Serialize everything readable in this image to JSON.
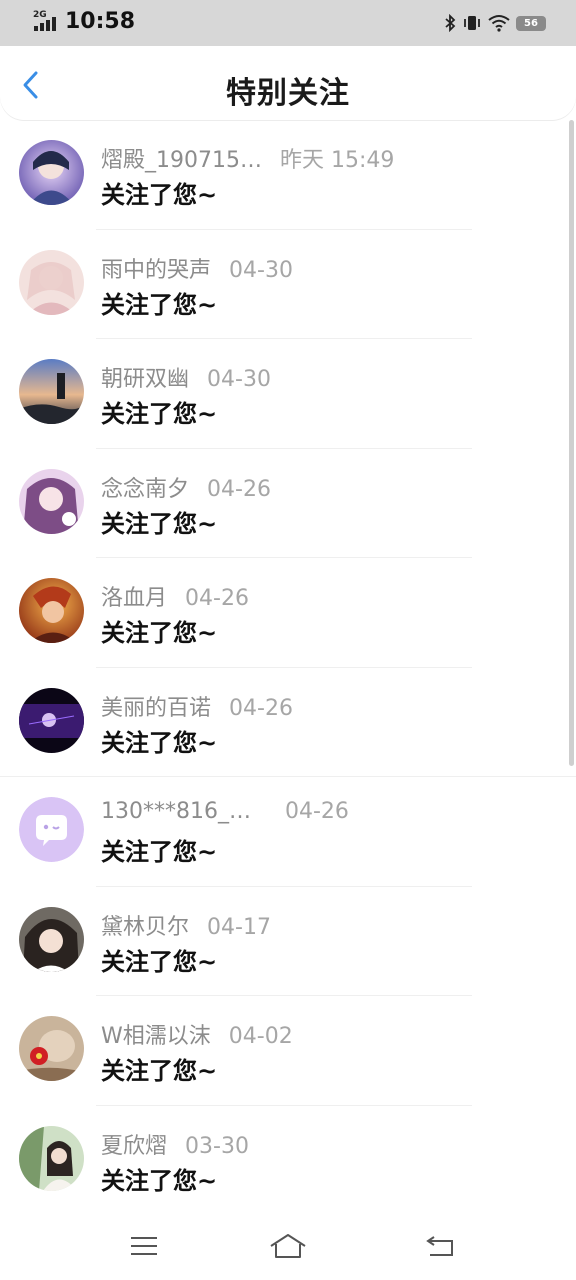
{
  "status_bar": {
    "network": "2G",
    "time": "10:58",
    "battery": "56"
  },
  "header": {
    "title": "特别关注"
  },
  "items": [
    {
      "name": "熠殿_190715…",
      "time": "昨天  15:49",
      "message": "关注了您~"
    },
    {
      "name": "雨中的哭声",
      "time": "04-30",
      "message": "关注了您~"
    },
    {
      "name": "朝研双幽",
      "time": "04-30",
      "message": "关注了您~"
    },
    {
      "name": "念念南夕",
      "time": "04-26",
      "message": "关注了您~"
    },
    {
      "name": "洛血月",
      "time": "04-26",
      "message": "关注了您~"
    },
    {
      "name": "美丽的百诺",
      "time": "04-26",
      "message": "关注了您~"
    },
    {
      "name": "130***816_…",
      "time": "04-26",
      "message": "关注了您~"
    },
    {
      "name": "黛林贝尔",
      "time": "04-17",
      "message": "关注了您~"
    },
    {
      "name": "W相濡以沫",
      "time": "04-02",
      "message": "关注了您~"
    },
    {
      "name": "夏欣熠",
      "time": "03-30",
      "message": "关注了您~"
    }
  ],
  "colors": {
    "accent": "#3a8ee6",
    "name_text": "#8c8c8c",
    "default_avatar": "#d9c4f5"
  }
}
